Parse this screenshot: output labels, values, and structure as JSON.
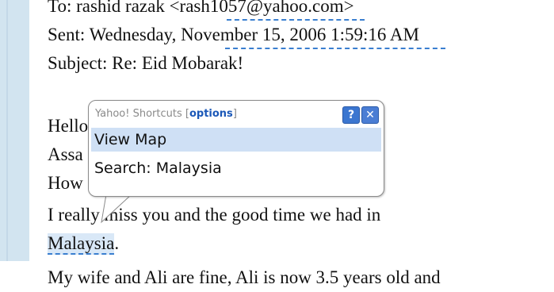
{
  "email": {
    "to_line": "To: rashid razak <rash1057@yahoo.com>",
    "sent_line": "Sent: Wednesday, November 15, 2006 1:59:16 AM",
    "subject_line": "Subject: Re: Eid Mobarak!",
    "line_hello": "Hello",
    "line_assa": "Assa",
    "line_how": "How are you? and the Family?",
    "line_miss": "I really miss you and the good time we had in",
    "line_malaysia_word": "Malaysia",
    "line_malaysia_dot": ".",
    "line_last": "My wife and Ali are fine, Ali is now 3.5 years old and"
  },
  "popup": {
    "title_prefix": "Yahoo! Shortcuts [",
    "title_options": "options",
    "title_suffix": "]",
    "help_label": "?",
    "close_label": "✕",
    "items": [
      {
        "label": "View Map"
      },
      {
        "label": "Search: Malaysia"
      }
    ]
  },
  "colors": {
    "accent": "#3a7fd0",
    "highlight": "#cfe0f5",
    "sidebar": "#d2e4f0"
  }
}
